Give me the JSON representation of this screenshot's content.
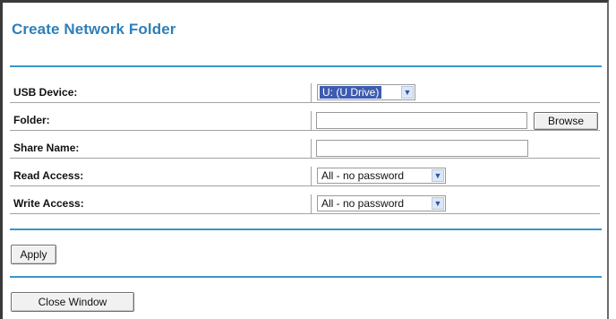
{
  "title": "Create Network Folder",
  "fields": {
    "usb_device": {
      "label": "USB Device:",
      "value": "U: (U Drive)"
    },
    "folder": {
      "label": "Folder:",
      "value": "",
      "browse_label": "Browse"
    },
    "share_name": {
      "label": "Share Name:",
      "value": ""
    },
    "read_access": {
      "label": "Read Access:",
      "value": "All - no password"
    },
    "write_access": {
      "label": "Write Access:",
      "value": "All - no password"
    }
  },
  "buttons": {
    "apply": "Apply",
    "close_window": "Close Window"
  },
  "colors": {
    "title": "#2e7fb8",
    "rule": "#3d94cc",
    "selection": "#3d5bb0"
  }
}
